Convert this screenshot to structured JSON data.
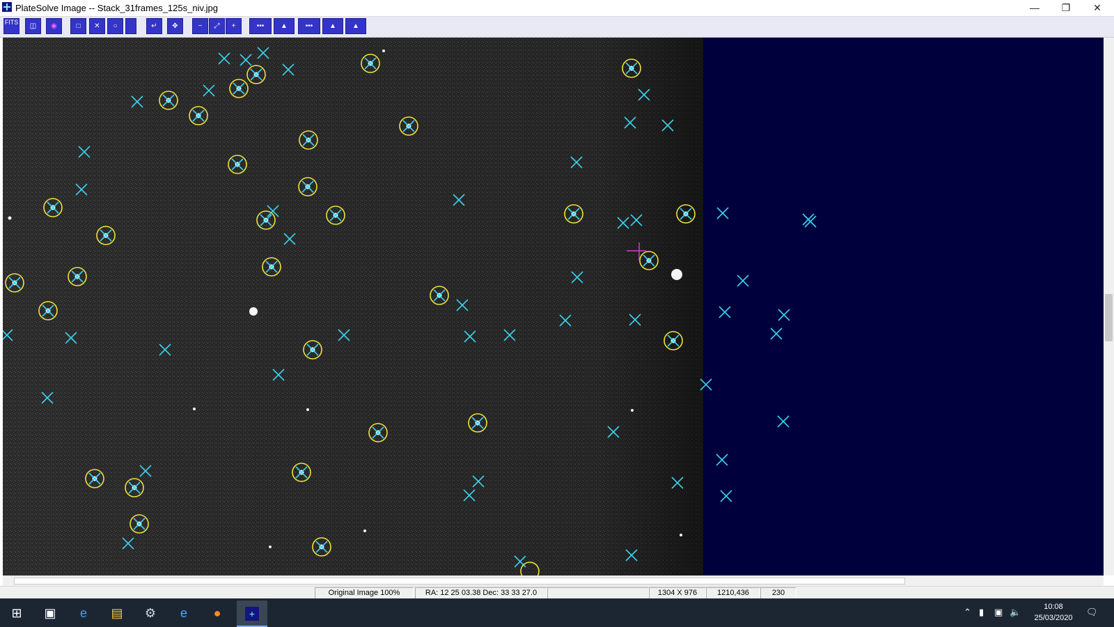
{
  "window": {
    "title": "PlateSolve Image -- Stack_31frames_125s_niv.jpg"
  },
  "toolbar": {
    "fits_label": "FITS"
  },
  "colors": {
    "star_circle": "#f0e13c",
    "catalog_cross": "#3ad2ee",
    "background_empty": "#00003c",
    "toolbar_button": "#3434c8"
  },
  "status": {
    "zoom": "Original Image 100%",
    "coords": "RA: 12 25 03.38  Dec: 33 33 27.0",
    "blank": "",
    "dims": "1304 X 976",
    "cursor": "1210,436",
    "value": "230"
  },
  "clock": {
    "time": "10:08",
    "date": "25/03/2020"
  },
  "icons": [
    "start-icon",
    "task-view-icon",
    "edge-icon",
    "file-explorer-icon",
    "control-panel-icon",
    "ie-icon",
    "firefox-icon",
    "platesolve-icon",
    "chevron-up-icon",
    "usb-icon",
    "network-icon",
    "volume-icon",
    "notification-icon"
  ]
}
